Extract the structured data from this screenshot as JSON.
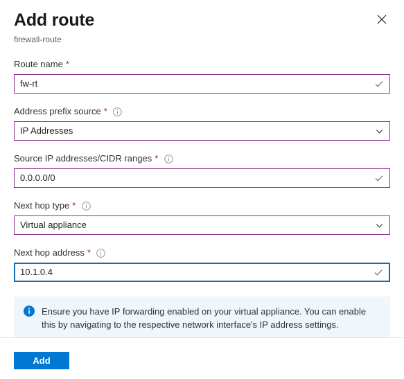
{
  "header": {
    "title": "Add route",
    "subtitle": "firewall-route",
    "close_icon": "close-icon"
  },
  "form": {
    "fields": [
      {
        "label": "Route name",
        "required_mark": "*",
        "has_info": false,
        "type": "text",
        "value": "fw-rt",
        "placeholder": "",
        "state": "valid",
        "affix_icon": "checkmark-icon"
      },
      {
        "label": "Address prefix source",
        "required_mark": "*",
        "has_info": true,
        "type": "select",
        "value": "IP Addresses",
        "placeholder": "",
        "state": "valid",
        "affix_icon": "chevron-down-icon"
      },
      {
        "label": "Source IP addresses/CIDR ranges",
        "required_mark": "*",
        "has_info": true,
        "type": "text",
        "value": "0.0.0.0/0",
        "placeholder": "",
        "state": "valid",
        "affix_icon": "checkmark-icon"
      },
      {
        "label": "Next hop type",
        "required_mark": "*",
        "has_info": true,
        "type": "select",
        "value": "Virtual appliance",
        "placeholder": "",
        "state": "valid",
        "affix_icon": "chevron-down-icon"
      },
      {
        "label": "Next hop address",
        "required_mark": "*",
        "has_info": true,
        "type": "text",
        "value": "10.1.0.4",
        "placeholder": "",
        "state": "focused",
        "affix_icon": "checkmark-icon"
      }
    ]
  },
  "info_banner": {
    "icon": "info-filled-icon",
    "text": "Ensure you have IP forwarding enabled on your virtual appliance. You can enable this by navigating to the respective network interface's IP address settings."
  },
  "footer": {
    "primary_button_label": "Add"
  },
  "colors": {
    "accent_blue": "#0078d4",
    "focus_blue": "#0f6cbd",
    "visited_purple": "#8a2f8f",
    "required_red": "#a4262c",
    "banner_bg": "#eff6fc",
    "text_primary": "#323130",
    "text_secondary": "#605e5c",
    "divider": "#e1dfdd"
  }
}
